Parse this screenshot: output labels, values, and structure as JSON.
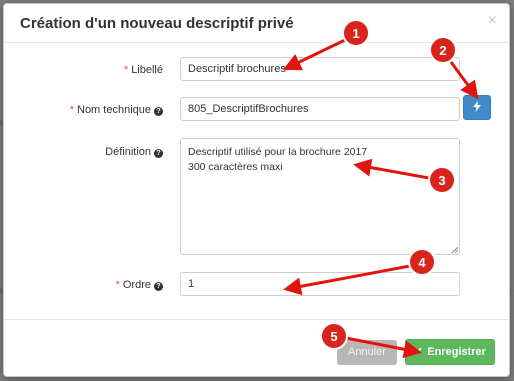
{
  "background": {
    "left_edge_text_1": "d",
    "left_edge_text_2": "d",
    "right_edge_text": "R"
  },
  "modal": {
    "title": "Création d'un nouveau descriptif privé",
    "close_symbol": "×"
  },
  "form": {
    "required_mark": "*",
    "libelle": {
      "label": "Libellé",
      "value": "Descriptif brochures"
    },
    "nom_technique": {
      "label": "Nom technique",
      "value": "805_DescriptifBrochures",
      "help_icon": "question-circle-icon"
    },
    "definition": {
      "label": "Définition",
      "value_line1": "Descriptif utilisé pour la brochure  2017",
      "value_line2": "300 caractères maxi",
      "help_icon": "question-circle-icon"
    },
    "ordre": {
      "label": "Ordre",
      "value": "1",
      "help_icon": "question-circle-icon"
    },
    "generate_button_icon": "bolt-icon"
  },
  "footer": {
    "cancel_label": "Annuler",
    "save_label": "Enregistrer",
    "save_icon": "check-icon"
  },
  "annotations": {
    "badges": [
      "1",
      "2",
      "3",
      "4",
      "5"
    ],
    "badge_color": "#d9231d",
    "arrow_color": "#e3140f"
  },
  "colors": {
    "primary": "#428bca",
    "success": "#5cb85c",
    "required": "#d9534f"
  }
}
